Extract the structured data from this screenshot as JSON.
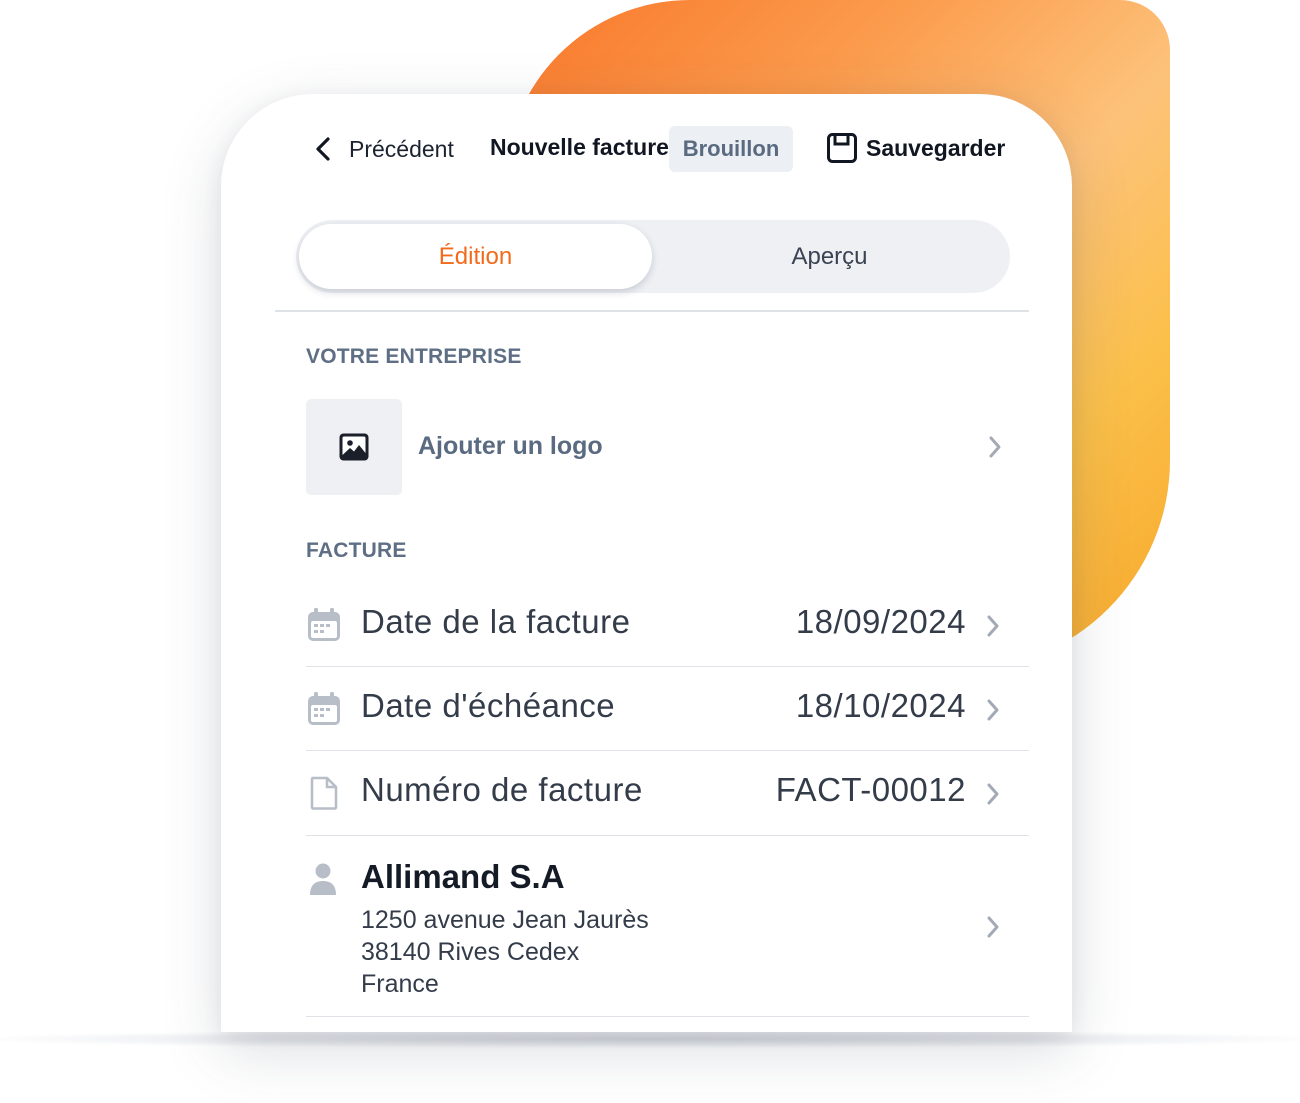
{
  "header": {
    "back_label": "Précédent",
    "title": "Nouvelle facture",
    "status_badge": "Brouillon",
    "save_label": "Sauvegarder"
  },
  "tabs": [
    {
      "label": "Édition",
      "active": true
    },
    {
      "label": "Aperçu",
      "active": false
    }
  ],
  "company_section": {
    "title": "VOTRE ENTREPRISE",
    "add_logo_label": "Ajouter un logo",
    "logo_icon": "image-icon"
  },
  "invoice_section": {
    "title": "FACTURE",
    "rows": [
      {
        "icon": "calendar-icon",
        "label": "Date de la facture",
        "value": "18/09/2024"
      },
      {
        "icon": "calendar-icon",
        "label": "Date d'échéance",
        "value": "18/10/2024"
      },
      {
        "icon": "document-icon",
        "label": "Numéro de facture",
        "value": "FACT-00012"
      }
    ]
  },
  "client": {
    "icon": "user-icon",
    "name": "Allimand S.A",
    "address_line1": "1250 avenue Jean Jaurès",
    "address_line2": "38140 Rives Cedex",
    "country": "France"
  },
  "colors": {
    "accent": "#f26a1b",
    "badge_bg": "#eceff3",
    "muted_text": "#5e6e85"
  }
}
